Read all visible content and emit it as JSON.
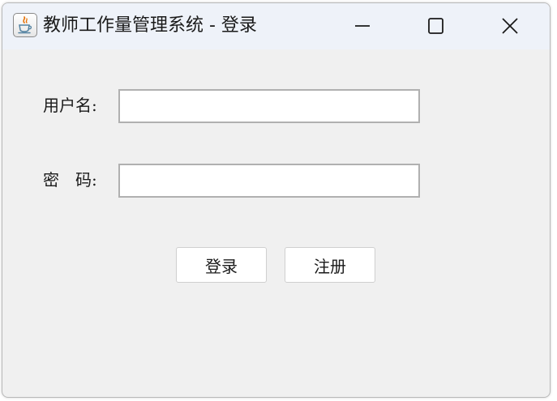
{
  "window": {
    "title": "教师工作量管理系统 - 登录",
    "icon": "java-cup-icon"
  },
  "title_controls": {
    "minimize": "minimize-icon",
    "maximize": "maximize-icon",
    "close": "close-icon"
  },
  "form": {
    "username_label": "用户名:",
    "username_value": "",
    "password_label": "密　码:",
    "password_value": ""
  },
  "buttons": {
    "login_label": "登录",
    "register_label": "注册"
  },
  "colors": {
    "title_bar": "#eef2f9",
    "window_background": "#f0f0f0",
    "field_border": "#b0b0b0",
    "java_cup_red": "#e76f00",
    "java_cup_blue": "#5382a1"
  }
}
